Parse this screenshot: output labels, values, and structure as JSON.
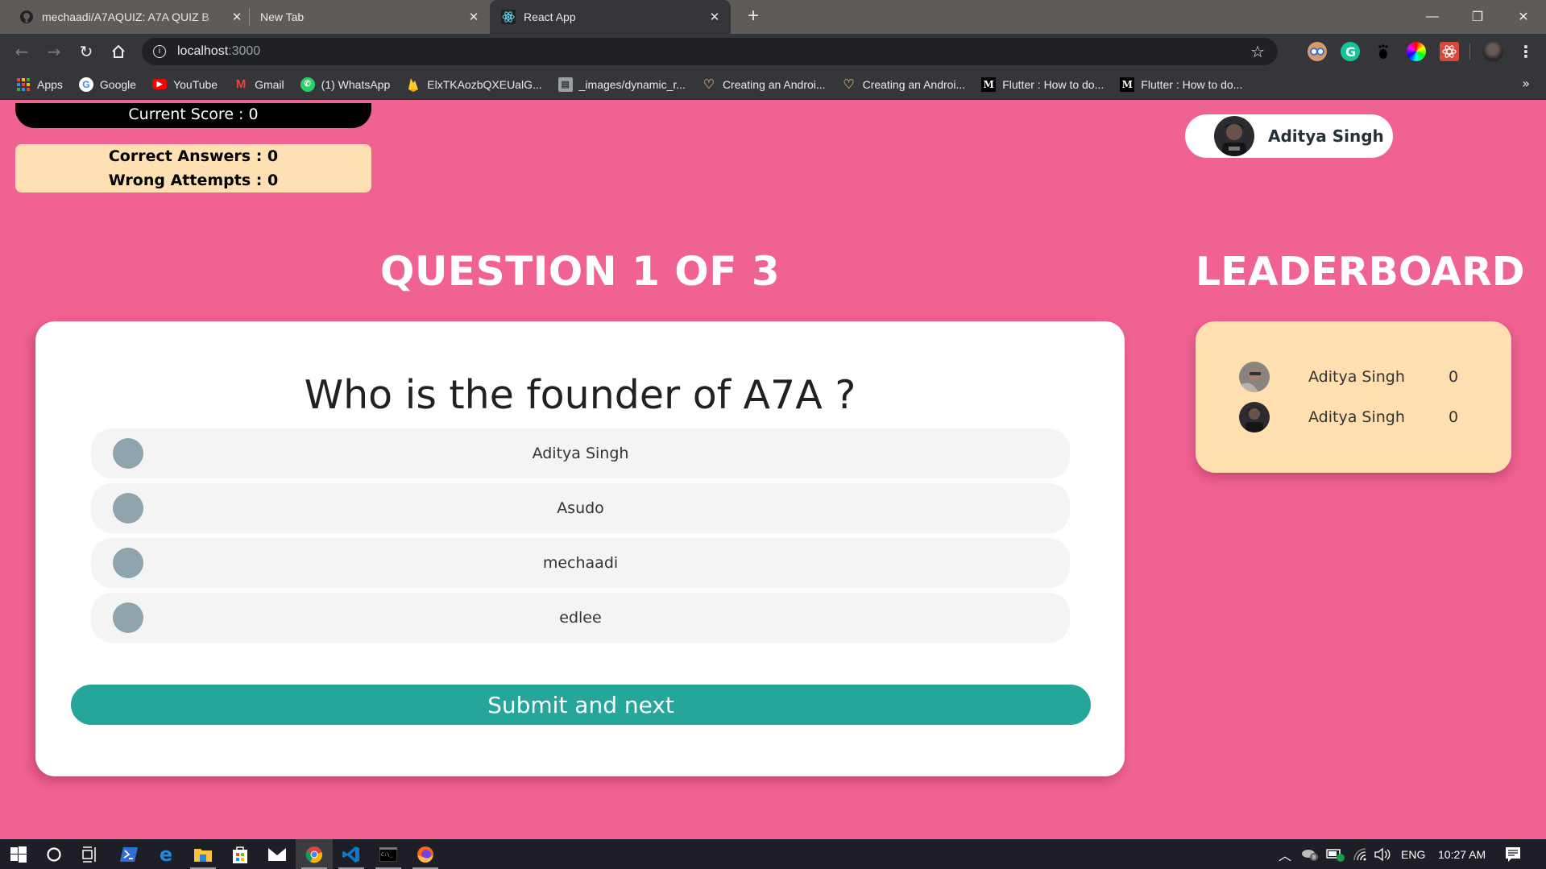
{
  "browser": {
    "tabs": [
      {
        "title": "mechaadi/A7AQUIZ: A7A QUIZ B",
        "icon": "github-icon",
        "active": false
      },
      {
        "title": "New Tab",
        "icon": "none",
        "active": false
      },
      {
        "title": "React App",
        "icon": "react-icon",
        "active": true
      }
    ],
    "new_tab_label": "+",
    "window_controls": {
      "minimize": "—",
      "restore": "❐",
      "close": "✕"
    },
    "address": {
      "host": "localhost",
      "port": ":3000"
    },
    "extensions": [
      "toby-extension-icon",
      "grammarly-icon",
      "gnome-extension-icon",
      "color-picker-icon",
      "react-devtools-icon"
    ],
    "bookmarks": [
      {
        "label": "Apps",
        "icon": "apps-grid-icon"
      },
      {
        "label": "Google",
        "icon": "google-icon"
      },
      {
        "label": "YouTube",
        "icon": "youtube-icon"
      },
      {
        "label": "Gmail",
        "icon": "gmail-icon"
      },
      {
        "label": "(1) WhatsApp",
        "icon": "whatsapp-icon"
      },
      {
        "label": "ElxTKAozbQXEUalG...",
        "icon": "firebase-icon"
      },
      {
        "label": "_images/dynamic_r...",
        "icon": "document-icon"
      },
      {
        "label": "Creating an Androi...",
        "icon": "heart-logo-icon"
      },
      {
        "label": "Creating an Androi...",
        "icon": "heart-logo-icon"
      },
      {
        "label": "Flutter : How to do...",
        "icon": "medium-icon"
      },
      {
        "label": "Flutter : How to do...",
        "icon": "medium-icon"
      }
    ],
    "bookmarks_overflow": "»"
  },
  "app": {
    "score": {
      "label": "Current Score",
      "value": "0"
    },
    "stats": {
      "correct_label": "Correct Answers",
      "correct_value": "0",
      "wrong_label": "Wrong Attempts",
      "wrong_value": "0"
    },
    "user": {
      "name": "Aditya Singh"
    },
    "question_heading": {
      "prefix": "QUESTION",
      "current": "1",
      "of": "OF",
      "total": "3"
    },
    "question_text": "Who is the founder of A7A ?",
    "options": [
      "Aditya Singh",
      "Asudo",
      "mechaadi",
      "edlee"
    ],
    "submit_label": "Submit and next",
    "leaderboard": {
      "title": "LEADERBOARD",
      "entries": [
        {
          "name": "Aditya Singh",
          "score": "0"
        },
        {
          "name": "Aditya Singh",
          "score": "0"
        }
      ]
    },
    "colors": {
      "background": "#f06292",
      "accent": "#26a69a",
      "stats_bg": "#ffe0b2",
      "leaderboard_bg": "#ffdeaf",
      "radio": "#90a4ae"
    }
  },
  "taskbar": {
    "apps": [
      "windows-start-icon",
      "cortana-icon",
      "task-view-icon",
      "powershell-icon",
      "edge-icon",
      "file-explorer-icon",
      "store-icon",
      "mail-icon",
      "chrome-icon",
      "vscode-icon",
      "terminal-icon",
      "firefox-icon"
    ],
    "active_app": "chrome-icon",
    "language": "ENG",
    "time": "10:27 AM"
  }
}
